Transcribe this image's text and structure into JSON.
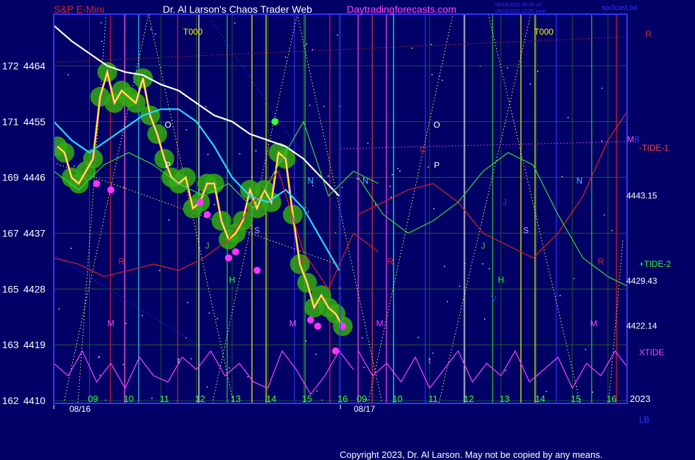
{
  "header": {
    "symbol": "S&P E-Mini",
    "title": "Dr. Al Larson's Chaos Trader Web",
    "site": "Daytradingforecasts.com",
    "stamp_line1": "08/16/2023 20:20 UT",
    "stamp_line2": "08/16/2023 13:20 local",
    "file": "spcfcast.txt"
  },
  "footer": {
    "copyright": "Copyright 2023, Dr. Al Larson. May not be copied by any means."
  },
  "colors": {
    "background": "#000066",
    "plot_border": "#3333ff",
    "price": "#ffff00",
    "ma_white": "#ffffff",
    "ma_cyan": "#22ddff",
    "tide_red": "#dd2222",
    "tide_green": "#33dd33",
    "xtide": "#ff44ff",
    "halo": "#33aa11"
  },
  "chart_data": {
    "type": "line",
    "title": "S&P E-Mini",
    "ylim": [
      4410,
      4478
    ],
    "y_ticks": [
      {
        "left": "172",
        "right": "4464",
        "value": 4464
      },
      {
        "left": "171",
        "right": "4455",
        "value": 4455
      },
      {
        "left": "169",
        "right": "4446",
        "value": 4446
      },
      {
        "left": "167",
        "right": "4437",
        "value": 4437
      },
      {
        "left": "165",
        "right": "4428",
        "value": 4428
      },
      {
        "left": "163",
        "right": "4419",
        "value": 4419
      },
      {
        "left": "162",
        "right": "4410",
        "value": 4410
      }
    ],
    "x_hours_day1": [
      {
        "label": "09",
        "t": 9
      },
      {
        "label": "10",
        "t": 10
      },
      {
        "label": "11",
        "t": 11
      },
      {
        "label": "12",
        "t": 12
      },
      {
        "label": "13",
        "t": 13
      },
      {
        "label": "14",
        "t": 14
      },
      {
        "label": "15",
        "t": 15
      },
      {
        "label": "16",
        "t": 16
      }
    ],
    "x_hours_day2": [
      {
        "label": "09",
        "t": 33
      },
      {
        "label": "10",
        "t": 34
      },
      {
        "label": "11",
        "t": 35
      },
      {
        "label": "12",
        "t": 36
      },
      {
        "label": "13",
        "t": 37
      },
      {
        "label": "14",
        "t": 38
      },
      {
        "label": "15",
        "t": 39
      },
      {
        "label": "16",
        "t": 40
      }
    ],
    "dates": [
      {
        "label": "08/16",
        "t": 8.4
      },
      {
        "label": "08/17",
        "t": 32.4
      }
    ],
    "year_label": "2023",
    "right_levels": [
      {
        "label": "4443.15",
        "value": 4443.15
      },
      {
        "label": "4429.43",
        "value": 4429.43
      },
      {
        "label": "4422.14",
        "value": 4422.14
      }
    ],
    "right_markers": [
      {
        "label": "R",
        "color": "#dd2222"
      },
      {
        "label": "MB",
        "color": "#ff44ff"
      },
      {
        "label": "-TIDE-1",
        "color": "#ff4444"
      },
      {
        "label": "+TIDE-2",
        "color": "#33ff33"
      },
      {
        "label": "XTIDE",
        "color": "#ff44ff"
      },
      {
        "label": "LB",
        "color": "#3333ff"
      }
    ],
    "annotations": [
      {
        "label": "T000",
        "t": 11.9,
        "value": 4469,
        "color": "#ffff00"
      },
      {
        "label": "T000",
        "t": 38.2,
        "value": 4469,
        "color": "#ffff00"
      },
      {
        "label": "O",
        "t": 11.2,
        "value": 4454,
        "color": "#ffffff"
      },
      {
        "label": "P",
        "t": 11.2,
        "value": 4447.5,
        "color": "#ffffff"
      },
      {
        "label": "O",
        "t": 35.2,
        "value": 4454,
        "color": "#ffffff"
      },
      {
        "label": "P",
        "t": 35.2,
        "value": 4447.5,
        "color": "#ffffff"
      },
      {
        "label": "N",
        "t": 15.2,
        "value": 4445,
        "color": "#33ccff"
      },
      {
        "label": "N",
        "t": 33.2,
        "value": 4445,
        "color": "#33ccff"
      },
      {
        "label": "N",
        "t": 39.2,
        "value": 4445,
        "color": "#33ccff"
      },
      {
        "label": "J",
        "t": 12.3,
        "value": 4434.5,
        "color": "#33cc33"
      },
      {
        "label": "J",
        "t": 36.5,
        "value": 4434.5,
        "color": "#33cc33"
      },
      {
        "label": "J",
        "t": 37.1,
        "value": 4441.5,
        "color": "#3333ff"
      },
      {
        "label": "S",
        "t": 13.7,
        "value": 4437,
        "color": "#aaaaff"
      },
      {
        "label": "S",
        "t": 37.7,
        "value": 4437,
        "color": "#aaaaff"
      },
      {
        "label": "H",
        "t": 13.0,
        "value": 4429,
        "color": "#33ff33"
      },
      {
        "label": "H",
        "t": 37.0,
        "value": 4429,
        "color": "#33ff33"
      },
      {
        "label": "V",
        "t": 36.8,
        "value": 4426,
        "color": "#3333ff"
      },
      {
        "label": "R",
        "t": 9.9,
        "value": 4432,
        "color": "#dd2222"
      },
      {
        "label": "R",
        "t": 15.0,
        "value": 4432,
        "color": "#dd2222"
      },
      {
        "label": "R",
        "t": 33.9,
        "value": 4432,
        "color": "#dd2222"
      },
      {
        "label": "R",
        "t": 39.8,
        "value": 4432,
        "color": "#dd2222"
      },
      {
        "label": "M",
        "t": 9.6,
        "value": 4422,
        "color": "#ff44ff"
      },
      {
        "label": "M",
        "t": 14.7,
        "value": 4422,
        "color": "#ff44ff"
      },
      {
        "label": "M",
        "t": 33.6,
        "value": 4422,
        "color": "#ff44ff"
      },
      {
        "label": "M",
        "t": 39.6,
        "value": 4422,
        "color": "#ff44ff"
      },
      {
        "label": "t",
        "t": 11.5,
        "value": 4416,
        "color": "#aaaaff"
      },
      {
        "label": "t",
        "t": 35.0,
        "value": 4416,
        "color": "#aaaaff"
      },
      {
        "label": "C",
        "t": 34.8,
        "value": 4450,
        "color": "#dd2222"
      }
    ],
    "series": [
      {
        "kind": "price",
        "x": [
          8.1,
          8.3,
          8.5,
          8.7,
          8.9,
          9.1,
          9.3,
          9.5,
          9.7,
          9.9,
          10.1,
          10.3,
          10.5,
          10.7,
          10.9,
          11.1,
          11.3,
          11.5,
          11.7,
          11.9,
          12.1,
          12.3,
          12.5,
          12.7,
          12.9,
          13.1,
          13.3,
          13.5,
          13.7,
          13.9,
          14.1,
          14.3,
          14.5,
          14.7,
          14.9,
          15.1,
          15.3,
          15.5,
          15.7,
          15.9,
          16.1
        ],
        "y": [
          4451,
          4450,
          4446,
          4445,
          4447,
          4449,
          4459,
          4463,
          4458,
          4460,
          4459,
          4458,
          4462,
          4456,
          4453,
          4449,
          4446,
          4445,
          4446,
          4441,
          4442,
          4445,
          4445,
          4439,
          4436,
          4437,
          4439,
          4444,
          4441,
          4444,
          4442,
          4450,
          4449,
          4440,
          4432,
          4429,
          4425,
          4427,
          4425,
          4424,
          4422
        ]
      },
      {
        "kind": "ma_white",
        "x": [
          8.0,
          8.5,
          9.0,
          9.5,
          10.0,
          10.5,
          11.0,
          11.5,
          12.0,
          12.5,
          13.0,
          13.5,
          14.0,
          14.5,
          15.0,
          15.5,
          16.0
        ],
        "y": [
          4470.5,
          4468,
          4466,
          4464,
          4463,
          4462.5,
          4461,
          4460,
          4458,
          4456,
          4455,
          4453,
          4452,
          4451,
          4449,
          4446,
          4443
        ]
      },
      {
        "kind": "ma_cyan",
        "x": [
          8.0,
          8.5,
          9.0,
          9.5,
          10.0,
          10.5,
          11.0,
          11.5,
          12.0,
          12.5,
          13.0,
          13.5,
          14.0,
          14.5,
          15.0,
          15.5,
          16.0
        ],
        "y": [
          4455,
          4452,
          4450,
          4452,
          4454,
          4456,
          4457,
          4457,
          4455,
          4451,
          4446,
          4443,
          4442,
          4444,
          4441,
          4436,
          4431
        ]
      },
      {
        "kind": "tide_red",
        "x": [
          8.0,
          8.7,
          9.4,
          10.1,
          10.8,
          11.5,
          12.2,
          12.9,
          13.6,
          14.3,
          15.0,
          15.7,
          16.4,
          17.1,
          33.0,
          33.7,
          34.4,
          35.1,
          35.8,
          36.5,
          37.2,
          37.9,
          38.6,
          39.3,
          40.0,
          40.7,
          41.4
        ],
        "y": [
          4433,
          4432,
          4430,
          4431,
          4432,
          4431,
          4433,
          4436,
          4442,
          4447,
          4434,
          4428,
          4437,
          4434,
          4440,
          4442,
          4444,
          4445,
          4442,
          4437,
          4435,
          4433,
          4437,
          4443,
          4452,
          4458,
          4454
        ]
      },
      {
        "kind": "tide_green",
        "x": [
          8.0,
          8.7,
          9.4,
          10.1,
          10.8,
          11.5,
          12.2,
          12.9,
          13.6,
          14.3,
          15.0,
          15.7,
          16.4,
          17.1,
          33.0,
          33.7,
          34.4,
          35.1,
          35.8,
          36.5,
          37.2,
          37.9,
          38.6,
          39.3,
          40.0,
          40.7,
          41.4
        ],
        "y": [
          4447,
          4444,
          4448,
          4450,
          4448,
          4445,
          4443,
          4445,
          4441,
          4448,
          4455,
          4443,
          4447,
          4445,
          4446,
          4440,
          4437,
          4439,
          4442,
          4447,
          4450,
          4448,
          4440,
          4433,
          4430,
          4428,
          4431
        ]
      },
      {
        "kind": "xtide",
        "x": [
          8.0,
          8.4,
          8.8,
          9.2,
          9.6,
          10.0,
          10.4,
          10.8,
          11.2,
          11.6,
          12.0,
          12.4,
          12.8,
          13.2,
          13.6,
          14.0,
          14.4,
          14.8,
          15.2,
          15.6,
          16.0,
          16.4,
          33.0,
          33.4,
          33.8,
          34.2,
          34.6,
          35.0,
          35.4,
          35.8,
          36.2,
          36.6,
          37.0,
          37.4,
          37.8,
          38.2,
          38.6,
          39.0,
          39.4,
          39.8,
          40.2,
          40.6,
          41.2
        ],
        "y": [
          4416,
          4414,
          4418,
          4413,
          4416,
          4412,
          4417,
          4414,
          4413,
          4417,
          4415,
          4418,
          4414,
          4416,
          4413,
          4412,
          4418,
          4415,
          4411,
          4414,
          4418,
          4415,
          4418,
          4414,
          4416,
          4413,
          4417,
          4412,
          4415,
          4418,
          4413,
          4416,
          4414,
          4418,
          4413,
          4415,
          4417,
          4412,
          4416,
          4414,
          4418,
          4415,
          4418
        ]
      }
    ],
    "magenta_dots": [
      {
        "t": 9.2,
        "value": 4445
      },
      {
        "t": 9.6,
        "value": 4444
      },
      {
        "t": 12.1,
        "value": 4442
      },
      {
        "t": 12.3,
        "value": 4440
      },
      {
        "t": 12.9,
        "value": 4433
      },
      {
        "t": 13.1,
        "value": 4434
      },
      {
        "t": 13.7,
        "value": 4431
      },
      {
        "t": 15.2,
        "value": 4423
      },
      {
        "t": 15.4,
        "value": 4422
      },
      {
        "t": 15.9,
        "value": 4418
      },
      {
        "t": 16.1,
        "value": 4422
      }
    ],
    "green_dot": {
      "t": 14.2,
      "value": 4455
    }
  }
}
